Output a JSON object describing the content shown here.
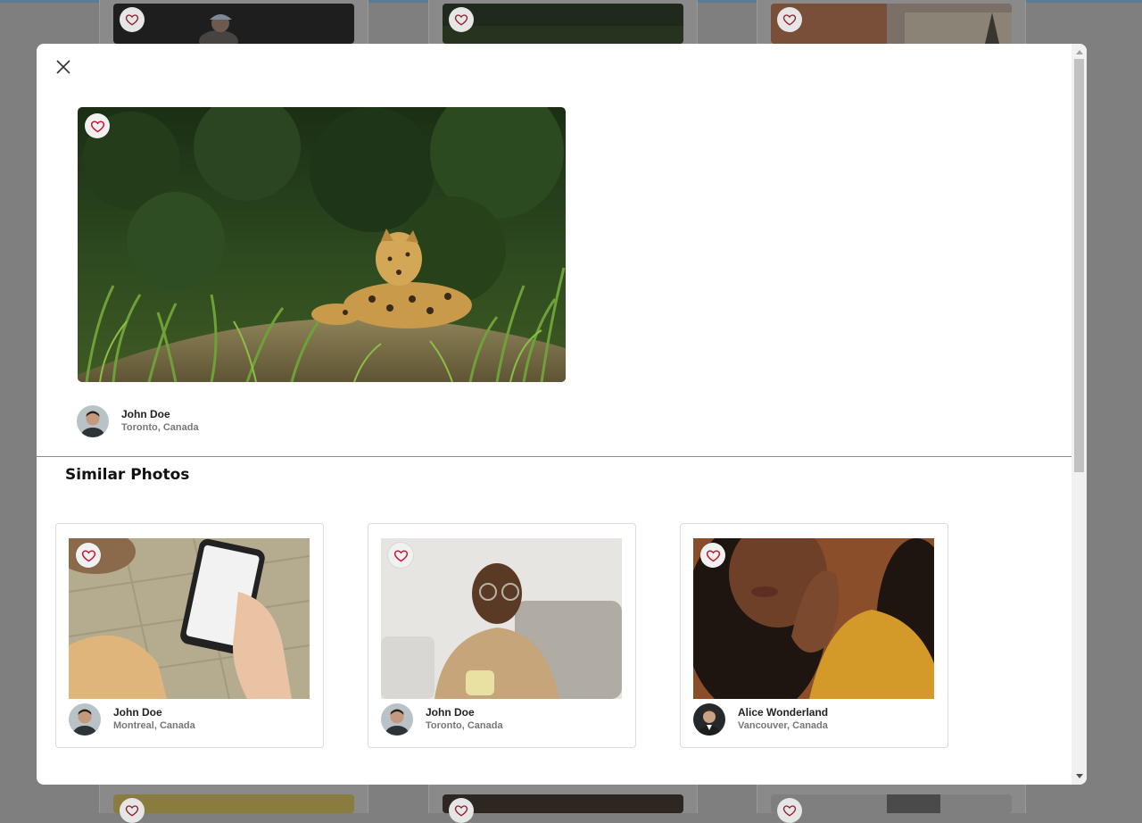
{
  "modal": {
    "close_label": "Close",
    "main_photo": {
      "alt": "Jaguar resting in tall grass",
      "author": {
        "name": "John Doe",
        "location": "Toronto, Canada"
      }
    },
    "similar_title": "Similar Photos",
    "similar": [
      {
        "alt": "Hand holding phone with payment app",
        "author": {
          "name": "John Doe",
          "location": "Montreal, Canada"
        }
      },
      {
        "alt": "Smiling man with glasses holding a mug",
        "author": {
          "name": "John Doe",
          "location": "Toronto, Canada"
        }
      },
      {
        "alt": "Woman with curly hair in yellow sweater",
        "author": {
          "name": "Alice Wonderland",
          "location": "Vancouver, Canada"
        }
      }
    ]
  },
  "colors": {
    "overlay": "#7f7f7f",
    "heart": "#c8102e",
    "accent_strip": "#5b7a93"
  },
  "icons": [
    "close-icon",
    "heart-icon",
    "scroll-up-icon",
    "scroll-down-icon"
  ]
}
